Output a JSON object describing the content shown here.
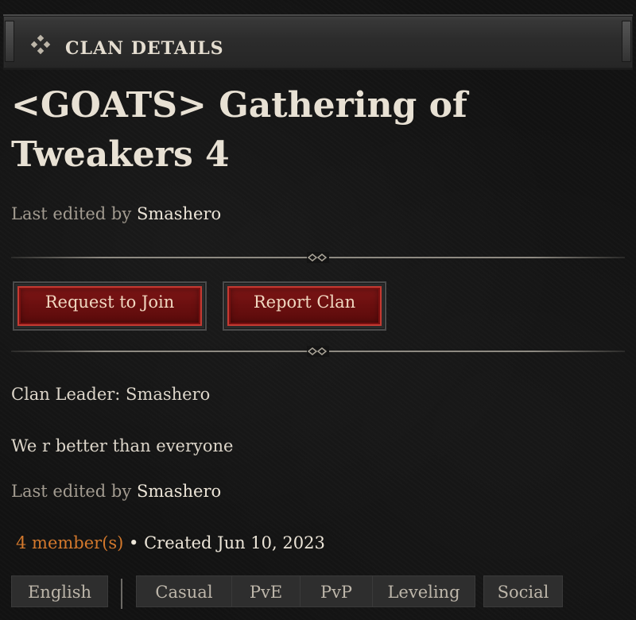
{
  "header": {
    "icon": "diamond-cluster-icon",
    "title": "CLAN DETAILS"
  },
  "clan": {
    "name": "<GOATS> Gathering of Tweakers 4",
    "last_edited_prefix": "Last edited by",
    "last_edited_by": "Smashero"
  },
  "actions": {
    "request_join_label": "Request to Join",
    "report_clan_label": "Report Clan"
  },
  "details": {
    "leader": "Clan Leader: Smashero",
    "description": "We r better than everyone",
    "last_edited_prefix": "Last edited by",
    "last_edited_by": "Smashero",
    "members": "4 member(s)",
    "created": " • Created Jun 10, 2023"
  },
  "tags": {
    "language": "English",
    "items": [
      "Casual",
      "PvE",
      "PvP",
      "Leveling",
      "Social"
    ]
  },
  "colors": {
    "members_accent": "#d3782c",
    "button_red": "#7e1616",
    "button_border": "#c43a32"
  }
}
